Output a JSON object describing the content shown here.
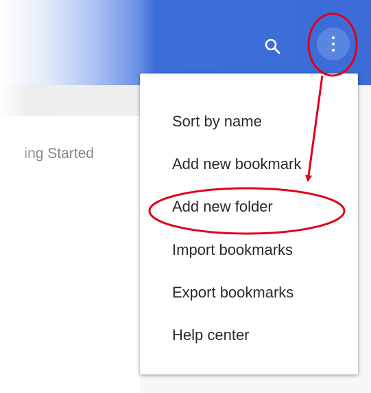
{
  "header": {
    "search_icon": "search-icon",
    "more_icon": "more-vert-icon",
    "accent_color": "#3b6cd8"
  },
  "breadcrumb": {
    "text": "ing Started"
  },
  "menu": {
    "items": [
      {
        "label": "Sort by name"
      },
      {
        "label": "Add new bookmark"
      },
      {
        "label": "Add new folder"
      },
      {
        "label": "Import bookmarks"
      },
      {
        "label": "Export bookmarks"
      },
      {
        "label": "Help center"
      }
    ]
  },
  "annotation": {
    "color": "#e0001b"
  }
}
